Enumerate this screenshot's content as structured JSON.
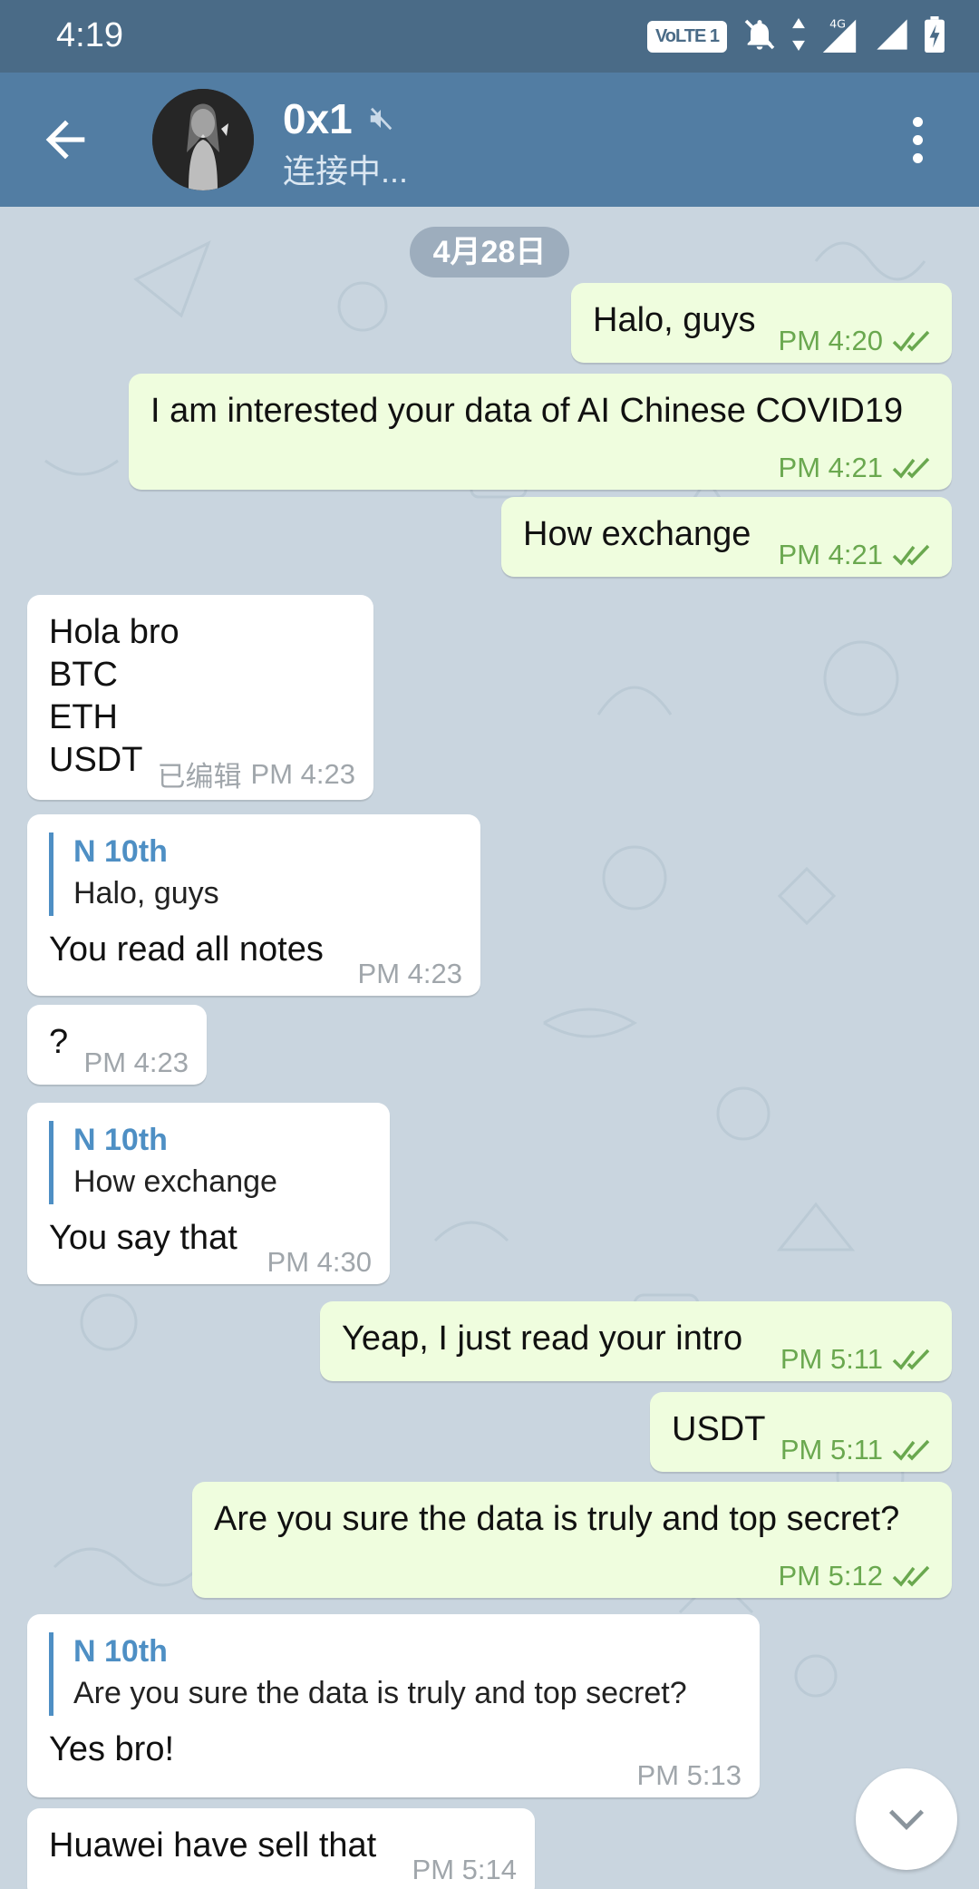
{
  "status_bar": {
    "time": "4:19",
    "volte": "VoLTE 1",
    "network": "4G"
  },
  "header": {
    "title": "0x1",
    "status": "连接中...",
    "muted_icon": "muted-speaker-icon"
  },
  "chat": {
    "date": "4月28日",
    "messages": [
      {
        "dir": "out",
        "text": "Halo, guys",
        "time": "PM 4:20"
      },
      {
        "dir": "out",
        "text": "I am interested your data of AI Chinese COVID19",
        "time": "PM 4:21"
      },
      {
        "dir": "out",
        "text": "How exchange",
        "time": "PM 4:21"
      },
      {
        "dir": "in",
        "lines": [
          "Hola bro",
          "BTC",
          "ETH",
          "USDT"
        ],
        "edited": "已编辑",
        "time": "PM 4:23"
      },
      {
        "dir": "in",
        "reply_name": "N 10th",
        "reply_text": "Halo, guys",
        "text": "You read all notes",
        "time": "PM 4:23"
      },
      {
        "dir": "in",
        "text": "?",
        "time": "PM 4:23"
      },
      {
        "dir": "in",
        "reply_name": "N 10th",
        "reply_text": "How exchange",
        "text": "You say that",
        "time": "PM 4:30"
      },
      {
        "dir": "out",
        "text": "Yeap, I just read your intro",
        "time": "PM 5:11"
      },
      {
        "dir": "out",
        "text": "USDT",
        "time": "PM 5:11"
      },
      {
        "dir": "out",
        "text": "Are you sure the data is truly and top secret?",
        "time": "PM 5:12"
      },
      {
        "dir": "in",
        "reply_name": "N 10th",
        "reply_text": "Are you sure the data is truly and top secret?",
        "text": "Yes bro!",
        "time": "PM 5:13"
      },
      {
        "dir": "in",
        "text": "Huawei have sell that",
        "time": "PM 5:14"
      }
    ]
  },
  "colors": {
    "header": "#527da3",
    "status_bar": "#4a6b87",
    "outgoing_bubble": "#effdde",
    "incoming_bubble": "#ffffff",
    "read_check": "#6aa84f",
    "reply_accent": "#4e8fc4"
  }
}
